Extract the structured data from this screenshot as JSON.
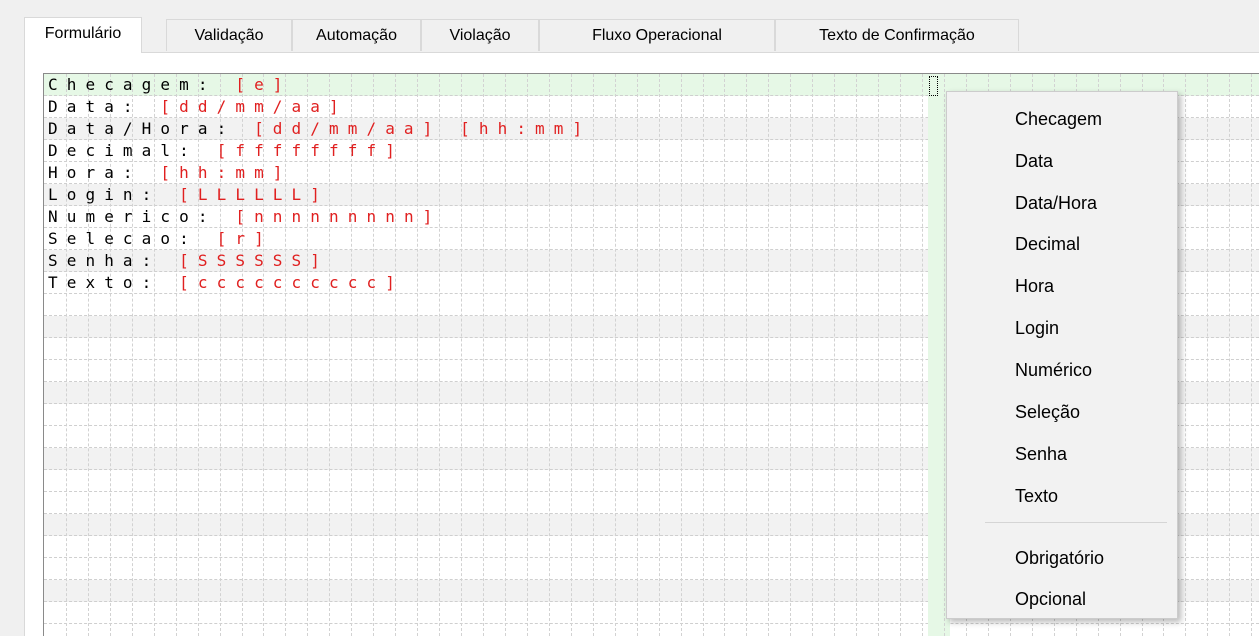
{
  "tabs": [
    {
      "label": "Formulário",
      "active": true
    },
    {
      "label": "Validação"
    },
    {
      "label": "Automação"
    },
    {
      "label": "Violação"
    },
    {
      "label": "Fluxo Operacional"
    },
    {
      "label": "Texto de Confirmação"
    }
  ],
  "editor": {
    "lines": [
      {
        "label": "Checagem:",
        "field": "[e]"
      },
      {
        "label": "Data:",
        "field": "[dd/mm/aa]"
      },
      {
        "label": "Data/Hora:",
        "field": "[dd/mm/aa] [hh:mm]"
      },
      {
        "label": "Decimal:",
        "field": "[ffffffff]"
      },
      {
        "label": "Hora:",
        "field": "[hh:mm]"
      },
      {
        "label": "Login:",
        "field": "[LLLLLL]"
      },
      {
        "label": "Numerico:",
        "field": "[nnnnnnnnn]"
      },
      {
        "label": "Selecao:",
        "field": "[r]"
      },
      {
        "label": "Senha:",
        "field": "[SSSSSS]"
      },
      {
        "label": "Texto:",
        "field": "[cccccccccc]"
      }
    ]
  },
  "context_menu": {
    "items": [
      "Checagem",
      "Data",
      "Data/Hora",
      "Decimal",
      "Hora",
      "Login",
      "Numérico",
      "Seleção",
      "Senha",
      "Texto"
    ],
    "required_items": [
      "Obrigatório",
      "Opcional"
    ]
  },
  "colors": {
    "field_text": "#e02020",
    "current_row": "#e6f8e6",
    "alt_row": "#f2f2f2"
  }
}
